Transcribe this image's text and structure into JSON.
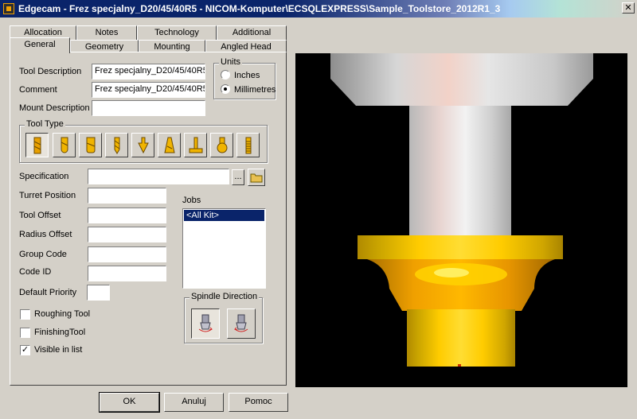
{
  "window": {
    "title": "Edgecam - Frez specjalny_D20/45/40R5 - NICOM-Komputer\\ECSQLEXPRESS\\Sample_Toolstore_2012R1_3",
    "close_glyph": "✕",
    "app_icon": "edgecam-icon"
  },
  "tabs": {
    "row_back": [
      "Allocation",
      "Notes",
      "Technology",
      "Additional"
    ],
    "row_front": [
      "General",
      "Geometry",
      "Mounting",
      "Angled Head"
    ],
    "active": "General"
  },
  "form": {
    "tool_description": {
      "label": "Tool Description",
      "value": "Frez specjalny_D20/45/40R5"
    },
    "comment": {
      "label": "Comment",
      "value": "Frez specjalny_D20/45/40R5"
    },
    "mount_description": {
      "label": "Mount Description",
      "value": ""
    },
    "specification": {
      "label": "Specification",
      "value": "",
      "browse_label": "..."
    },
    "turret_position": {
      "label": "Turret Position",
      "value": ""
    },
    "tool_offset": {
      "label": "Tool Offset",
      "value": ""
    },
    "radius_offset": {
      "label": "Radius Offset",
      "value": ""
    },
    "group_code": {
      "label": "Group Code",
      "value": ""
    },
    "code_id": {
      "label": "Code ID",
      "value": ""
    },
    "default_priority": {
      "label": "Default Priority",
      "value": ""
    }
  },
  "units": {
    "label": "Units",
    "options": [
      "Inches",
      "Millimetres"
    ],
    "selected": "Millimetres"
  },
  "tool_type": {
    "label": "Tool Type",
    "icons": [
      "endmill-icon",
      "ballnose-icon",
      "bullnose-icon",
      "drill-icon",
      "chamfer-icon",
      "taper-icon",
      "slot-icon",
      "form-icon",
      "tap-icon"
    ],
    "selected_index": 0
  },
  "jobs": {
    "label": "Jobs",
    "items": [
      "<All Kit>"
    ],
    "selected": "<All Kit>"
  },
  "spindle_direction": {
    "label": "Spindle Direction",
    "options": [
      "spindle-cw-icon",
      "spindle-ccw-icon"
    ],
    "selected_index": 0
  },
  "checkboxes": [
    {
      "label": "Roughing Tool",
      "checked": false
    },
    {
      "label": "FinishingTool",
      "checked": false
    },
    {
      "label": "Visible in list",
      "checked": true
    }
  ],
  "buttons": {
    "ok": "OK",
    "cancel": "Anuluj",
    "help": "Pomoc"
  },
  "colors": {
    "accent": "#0a246a",
    "tool_yellow": "#f5c400",
    "tool_orange": "#e8a000",
    "shank_grey": "#d9d9d9"
  }
}
